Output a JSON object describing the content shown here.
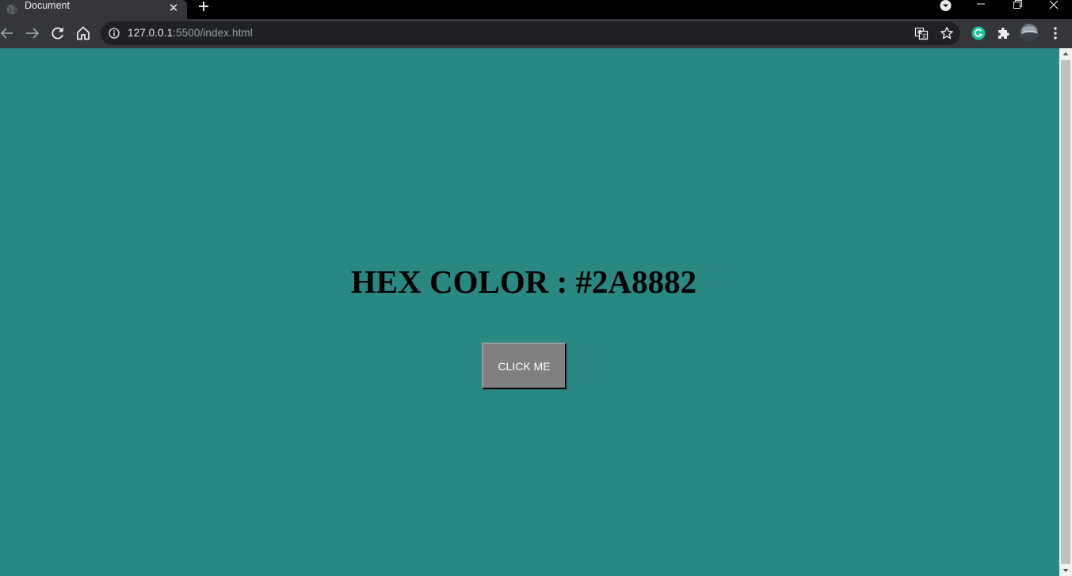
{
  "browser": {
    "tab": {
      "title": "Document",
      "favicon": "globe-icon",
      "close": "✕"
    },
    "new_tab": "plus-icon",
    "window_controls": [
      "minimize-icon",
      "restore-icon",
      "close-icon"
    ],
    "toolbar": {
      "back": "back-arrow-icon",
      "forward": "forward-arrow-icon",
      "reload": "reload-icon",
      "home": "home-icon"
    },
    "omnibox": {
      "host": "127.0.0.1",
      "rest": ":5500/index.html",
      "info_icon": "info-icon",
      "translate_icon": "translate-icon",
      "star_icon": "bookmark-star-icon"
    },
    "extensions": [
      "grammarly-icon",
      "extensions-puzzle-icon"
    ],
    "menu": "kebab-menu-icon"
  },
  "page": {
    "background": "#2a8882",
    "heading": "HEX COLOR : #2A8882",
    "button_label": "CLICK ME"
  },
  "colors": {
    "tab_active": "#35363a",
    "toolbar": "#35363a",
    "omnibox": "#202124",
    "button": "#808080",
    "grammarly": "#15c39a"
  }
}
